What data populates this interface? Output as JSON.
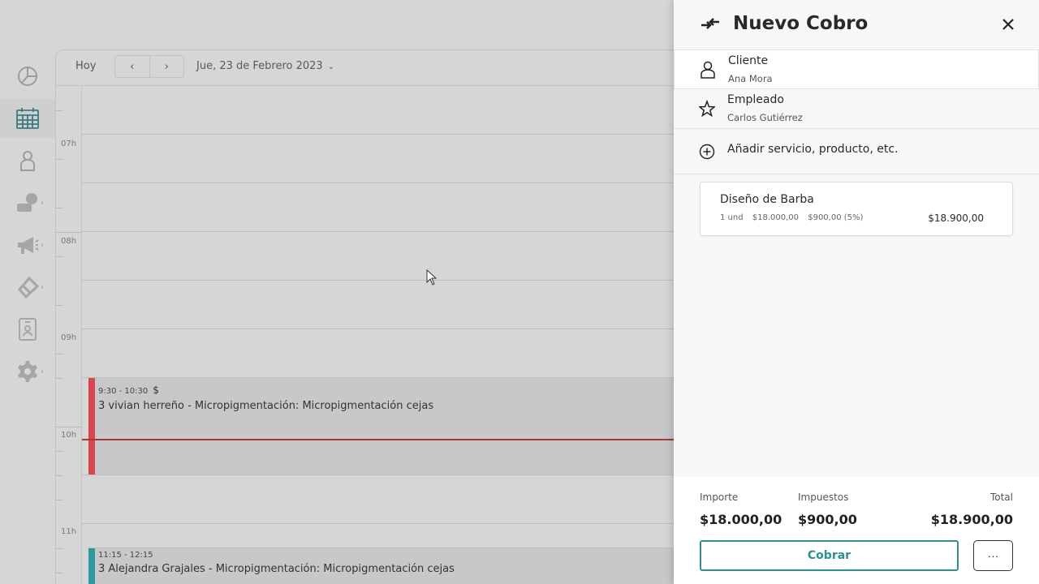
{
  "calendar": {
    "today_label": "Hoy",
    "prev_label": "‹",
    "next_label": "›",
    "date_label": "Jue, 23 de Febrero 2023",
    "hours": [
      "07h",
      "08h",
      "09h",
      "10h",
      "11h"
    ],
    "events": [
      {
        "time": "9:30 - 10:30",
        "has_payment": "$",
        "title": "3 vivian herreño - Micropigmentación: Micropigmentación cejas",
        "color": "#d9464e"
      },
      {
        "time": "11:15 - 12:15",
        "title": "3 Alejandra Grajales - Micropigmentación: Micropigmentación cejas",
        "color": "#2a9a9c"
      }
    ]
  },
  "sidebar": {
    "items": [
      {
        "icon": "pie-chart-icon",
        "active": false
      },
      {
        "icon": "calendar-icon",
        "active": true
      },
      {
        "icon": "user-icon",
        "active": false
      },
      {
        "icon": "money-icon",
        "active": false,
        "has_submenu": true
      },
      {
        "icon": "megaphone-icon",
        "active": false,
        "has_submenu": true
      },
      {
        "icon": "tag-icon",
        "active": false,
        "has_submenu": true
      },
      {
        "icon": "id-card-icon",
        "active": false
      },
      {
        "icon": "gear-icon",
        "active": false,
        "has_submenu": true
      }
    ]
  },
  "drawer": {
    "title": "Nuevo Cobro",
    "client": {
      "label": "Cliente",
      "value": "Ana Mora"
    },
    "employee": {
      "label": "Empleado",
      "value": "Carlos Gutiérrez"
    },
    "add_label": "Añadir servicio, producto, etc.",
    "item": {
      "name": "Diseño de Barba",
      "quantity": "1 und",
      "unit_price": "$18.000,00",
      "tax": "$900,00 (5%)",
      "total": "$18.900,00"
    },
    "summary": {
      "importe_label": "Importe",
      "importe_value": "$18.000,00",
      "impuestos_label": "Impuestos",
      "impuestos_value": "$900,00",
      "total_label": "Total",
      "total_value": "$18.900,00"
    },
    "pay_label": "Cobrar",
    "more_label": "···"
  },
  "colors": {
    "accent": "#2f8f8f",
    "now_line": "#a23a3a"
  }
}
